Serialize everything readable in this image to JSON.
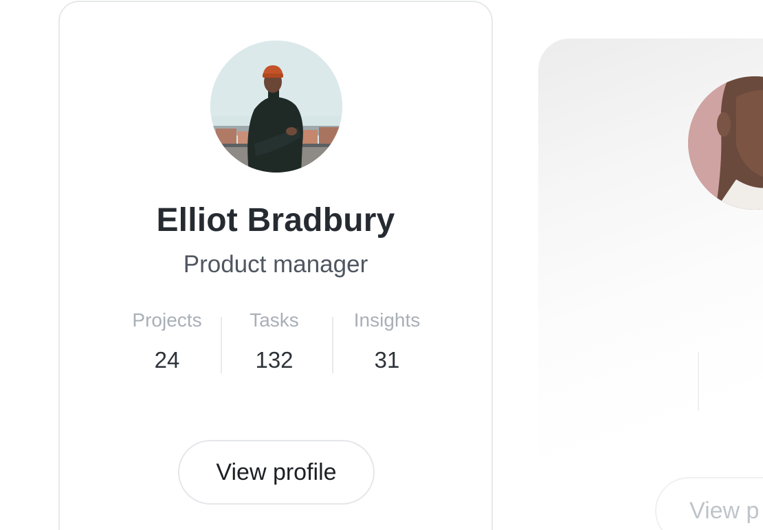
{
  "profile_card": {
    "name": "Elliot Bradbury",
    "role": "Product manager",
    "stats": [
      {
        "label": "Projects",
        "value": "24"
      },
      {
        "label": "Tasks",
        "value": "132"
      },
      {
        "label": "Insights",
        "value": "31"
      }
    ],
    "button_label": "View profile"
  },
  "next_card": {
    "button_label": "View p"
  },
  "colors": {
    "name_text": "#262b31",
    "role_text": "#4f5660",
    "stat_label": "#a9afb7",
    "stat_value": "#2c3238",
    "card_border": "#e6e8ea"
  },
  "icons": {
    "avatar_primary": "person-photo",
    "avatar_secondary": "person-photo"
  }
}
